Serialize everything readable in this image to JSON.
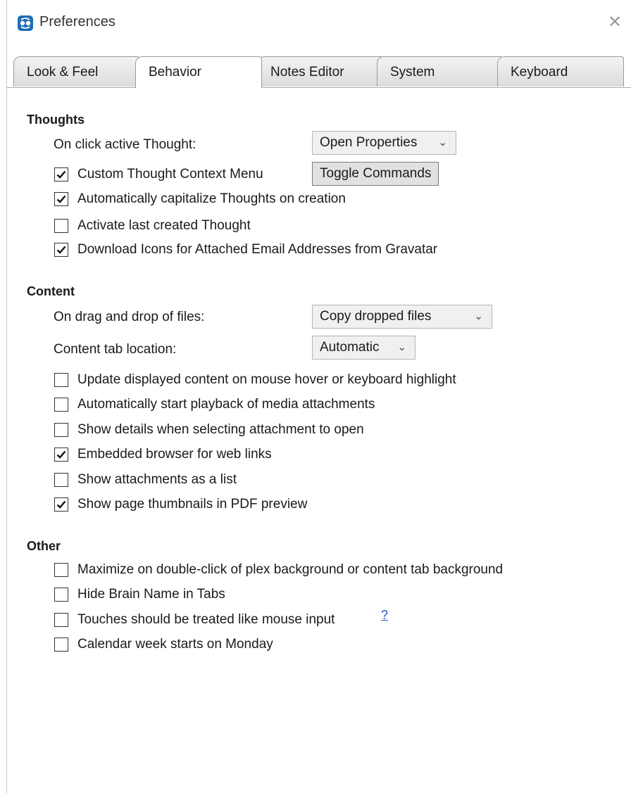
{
  "window": {
    "title": "Preferences",
    "close_symbol": "✕"
  },
  "tabs": [
    {
      "label": "Look & Feel"
    },
    {
      "label": "Behavior"
    },
    {
      "label": "Notes Editor"
    },
    {
      "label": "System"
    },
    {
      "label": "Keyboard"
    }
  ],
  "active_tab": "Behavior",
  "thoughts": {
    "title": "Thoughts",
    "on_click_label": "On click active Thought:",
    "on_click_value": "Open Properties",
    "toggle_commands_label": "Toggle Commands",
    "options": [
      {
        "label": "Custom Thought Context Menu",
        "checked": true
      },
      {
        "label": "Automatically capitalize Thoughts on creation",
        "checked": true
      },
      {
        "label": "Activate last created Thought",
        "checked": false
      },
      {
        "label": "Download Icons for Attached Email Addresses from Gravatar",
        "checked": true
      }
    ]
  },
  "content": {
    "title": "Content",
    "drag_drop_label": "On drag and drop of files:",
    "drag_drop_value": "Copy dropped files",
    "tab_location_label": "Content tab location:",
    "tab_location_value": "Automatic",
    "options": [
      {
        "label": "Update displayed content on mouse hover or keyboard highlight",
        "checked": false
      },
      {
        "label": "Automatically start playback of media attachments",
        "checked": false
      },
      {
        "label": "Show details when selecting attachment to open",
        "checked": false
      },
      {
        "label": "Embedded browser for web links",
        "checked": true
      },
      {
        "label": "Show attachments as a list",
        "checked": false
      },
      {
        "label": "Show page thumbnails in PDF preview",
        "checked": true
      }
    ]
  },
  "other": {
    "title": "Other",
    "help_link": "?",
    "options": [
      {
        "label": "Maximize on double-click of plex background or content tab background",
        "checked": false
      },
      {
        "label": "Hide Brain Name in Tabs",
        "checked": false
      },
      {
        "label": "Touches should be treated like mouse input",
        "checked": false
      },
      {
        "label": "Calendar week starts on Monday",
        "checked": false
      }
    ]
  },
  "icons": {
    "app": "brain-app-icon",
    "dropdown": "chevron-down-icon",
    "check": "checkmark-icon",
    "close": "close-icon"
  },
  "colors": {
    "link": "#2458c6",
    "app_icon": "#1e6db5"
  }
}
